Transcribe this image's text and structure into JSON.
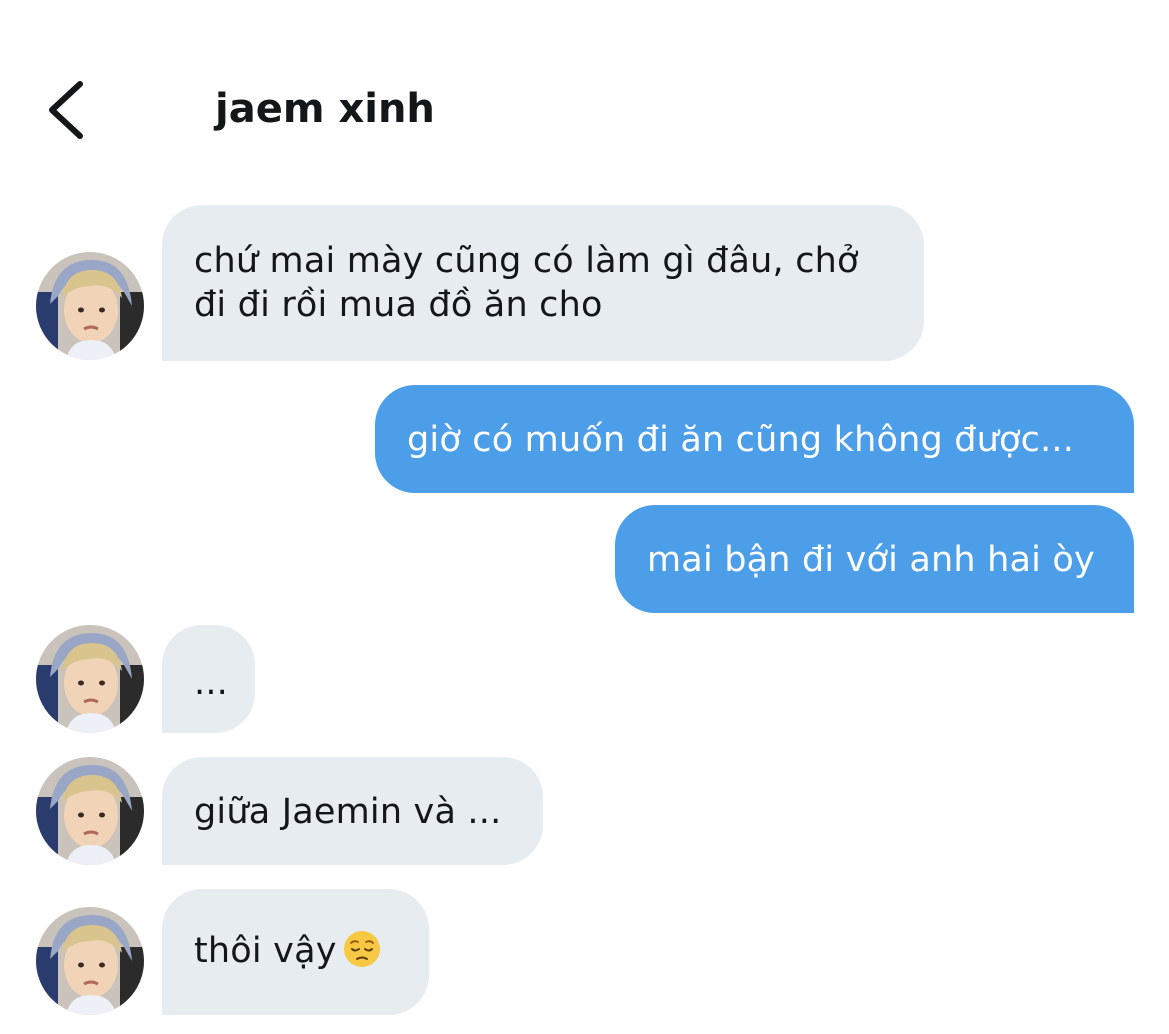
{
  "header": {
    "title": "jaem xinh",
    "back_icon": "chevron-left-icon"
  },
  "colors": {
    "incoming_bubble": "#e6ecf0",
    "outgoing_bubble": "#4d9ee9",
    "text": "#14171a"
  },
  "messages": [
    {
      "from": "them",
      "lines": [
        "chứ mai mày cũng có làm gì đâu, chở",
        "đi đi rồi mua đồ ăn cho"
      ]
    },
    {
      "from": "me",
      "text": "giờ có muốn đi ăn cũng không được..."
    },
    {
      "from": "me",
      "text": "mai bận đi với anh hai òy"
    },
    {
      "from": "them",
      "text": "..."
    },
    {
      "from": "them",
      "text": "giữa Jaemin và ..."
    },
    {
      "from": "them",
      "text": "thôi vậy",
      "emoji": "pensive-face-emoji"
    }
  ]
}
